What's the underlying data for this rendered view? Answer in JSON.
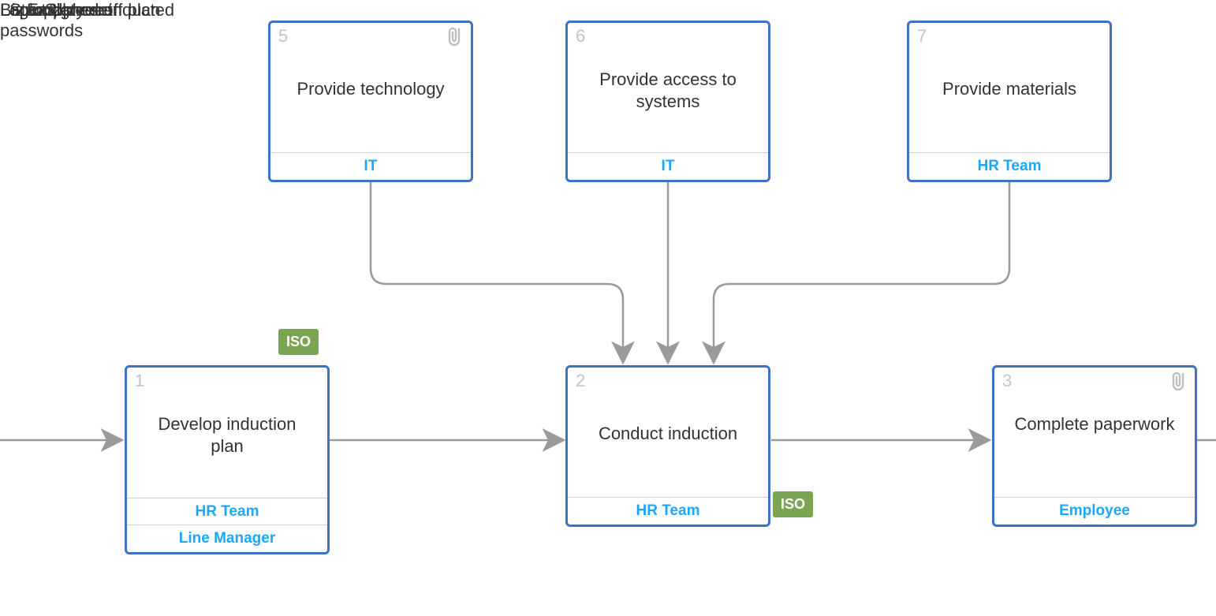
{
  "nodes": {
    "n1": {
      "num": "1",
      "title": "Develop induction plan",
      "roles": [
        "HR Team",
        "Line Manager"
      ],
      "iso": "ISO"
    },
    "n2": {
      "num": "2",
      "title": "Conduct induction",
      "roles": [
        "HR Team"
      ],
      "iso": "ISO"
    },
    "n3": {
      "num": "3",
      "title": "Complete paperwork",
      "roles": [
        "Employee"
      ],
      "attachment": true
    },
    "n5": {
      "num": "5",
      "title": "Provide technology",
      "roles": [
        "IT"
      ],
      "attachment": true
    },
    "n6": {
      "num": "6",
      "title": "Provide access to systems",
      "roles": [
        "IT"
      ]
    },
    "n7": {
      "num": "7",
      "title": "Provide materials",
      "roles": [
        "HR Team"
      ]
    }
  },
  "edges": {
    "start": {
      "label": "Start date set"
    },
    "e1_2": {
      "label": "Signed off plan"
    },
    "e2_3": {
      "label": "Employee inducted"
    },
    "e5_2": {
      "label": "Laptop, phone"
    },
    "e6_2": {
      "label": "Login & passwords"
    },
    "e7_2": {
      "label": "Biz cards"
    }
  }
}
